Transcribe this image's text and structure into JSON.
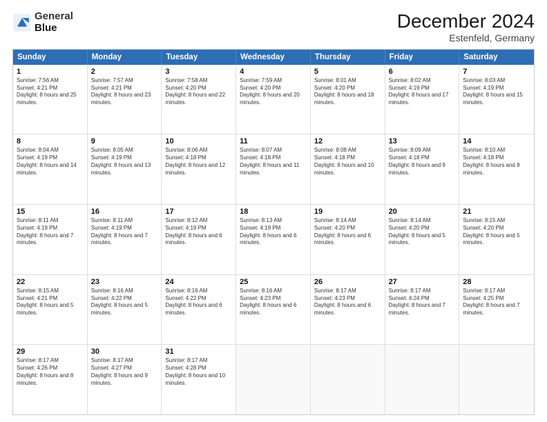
{
  "logo": {
    "line1": "General",
    "line2": "Blue"
  },
  "title": "December 2024",
  "subtitle": "Estenfeld, Germany",
  "days": [
    "Sunday",
    "Monday",
    "Tuesday",
    "Wednesday",
    "Thursday",
    "Friday",
    "Saturday"
  ],
  "weeks": [
    [
      {
        "day": "1",
        "sunrise": "7:56 AM",
        "sunset": "4:21 PM",
        "daylight": "8 hours and 25 minutes."
      },
      {
        "day": "2",
        "sunrise": "7:57 AM",
        "sunset": "4:21 PM",
        "daylight": "8 hours and 23 minutes."
      },
      {
        "day": "3",
        "sunrise": "7:58 AM",
        "sunset": "4:20 PM",
        "daylight": "8 hours and 22 minutes."
      },
      {
        "day": "4",
        "sunrise": "7:59 AM",
        "sunset": "4:20 PM",
        "daylight": "8 hours and 20 minutes."
      },
      {
        "day": "5",
        "sunrise": "8:01 AM",
        "sunset": "4:20 PM",
        "daylight": "8 hours and 18 minutes."
      },
      {
        "day": "6",
        "sunrise": "8:02 AM",
        "sunset": "4:19 PM",
        "daylight": "8 hours and 17 minutes."
      },
      {
        "day": "7",
        "sunrise": "8:03 AM",
        "sunset": "4:19 PM",
        "daylight": "8 hours and 15 minutes."
      }
    ],
    [
      {
        "day": "8",
        "sunrise": "8:04 AM",
        "sunset": "4:19 PM",
        "daylight": "8 hours and 14 minutes."
      },
      {
        "day": "9",
        "sunrise": "8:05 AM",
        "sunset": "4:19 PM",
        "daylight": "8 hours and 13 minutes."
      },
      {
        "day": "10",
        "sunrise": "8:06 AM",
        "sunset": "4:18 PM",
        "daylight": "8 hours and 12 minutes."
      },
      {
        "day": "11",
        "sunrise": "8:07 AM",
        "sunset": "4:18 PM",
        "daylight": "8 hours and 11 minutes."
      },
      {
        "day": "12",
        "sunrise": "8:08 AM",
        "sunset": "4:18 PM",
        "daylight": "8 hours and 10 minutes."
      },
      {
        "day": "13",
        "sunrise": "8:09 AM",
        "sunset": "4:18 PM",
        "daylight": "8 hours and 9 minutes."
      },
      {
        "day": "14",
        "sunrise": "8:10 AM",
        "sunset": "4:18 PM",
        "daylight": "8 hours and 8 minutes."
      }
    ],
    [
      {
        "day": "15",
        "sunrise": "8:11 AM",
        "sunset": "4:19 PM",
        "daylight": "8 hours and 7 minutes."
      },
      {
        "day": "16",
        "sunrise": "8:11 AM",
        "sunset": "4:19 PM",
        "daylight": "8 hours and 7 minutes."
      },
      {
        "day": "17",
        "sunrise": "8:12 AM",
        "sunset": "4:19 PM",
        "daylight": "8 hours and 6 minutes."
      },
      {
        "day": "18",
        "sunrise": "8:13 AM",
        "sunset": "4:19 PM",
        "daylight": "8 hours and 6 minutes."
      },
      {
        "day": "19",
        "sunrise": "8:14 AM",
        "sunset": "4:20 PM",
        "daylight": "8 hours and 6 minutes."
      },
      {
        "day": "20",
        "sunrise": "8:14 AM",
        "sunset": "4:20 PM",
        "daylight": "8 hours and 5 minutes."
      },
      {
        "day": "21",
        "sunrise": "8:15 AM",
        "sunset": "4:20 PM",
        "daylight": "8 hours and 5 minutes."
      }
    ],
    [
      {
        "day": "22",
        "sunrise": "8:15 AM",
        "sunset": "4:21 PM",
        "daylight": "8 hours and 5 minutes."
      },
      {
        "day": "23",
        "sunrise": "8:16 AM",
        "sunset": "4:22 PM",
        "daylight": "8 hours and 5 minutes."
      },
      {
        "day": "24",
        "sunrise": "8:16 AM",
        "sunset": "4:22 PM",
        "daylight": "8 hours and 6 minutes."
      },
      {
        "day": "25",
        "sunrise": "8:16 AM",
        "sunset": "4:23 PM",
        "daylight": "8 hours and 6 minutes."
      },
      {
        "day": "26",
        "sunrise": "8:17 AM",
        "sunset": "4:23 PM",
        "daylight": "8 hours and 6 minutes."
      },
      {
        "day": "27",
        "sunrise": "8:17 AM",
        "sunset": "4:24 PM",
        "daylight": "8 hours and 7 minutes."
      },
      {
        "day": "28",
        "sunrise": "8:17 AM",
        "sunset": "4:25 PM",
        "daylight": "8 hours and 7 minutes."
      }
    ],
    [
      {
        "day": "29",
        "sunrise": "8:17 AM",
        "sunset": "4:26 PM",
        "daylight": "8 hours and 8 minutes."
      },
      {
        "day": "30",
        "sunrise": "8:17 AM",
        "sunset": "4:27 PM",
        "daylight": "8 hours and 9 minutes."
      },
      {
        "day": "31",
        "sunrise": "8:17 AM",
        "sunset": "4:28 PM",
        "daylight": "8 hours and 10 minutes."
      },
      null,
      null,
      null,
      null
    ]
  ]
}
